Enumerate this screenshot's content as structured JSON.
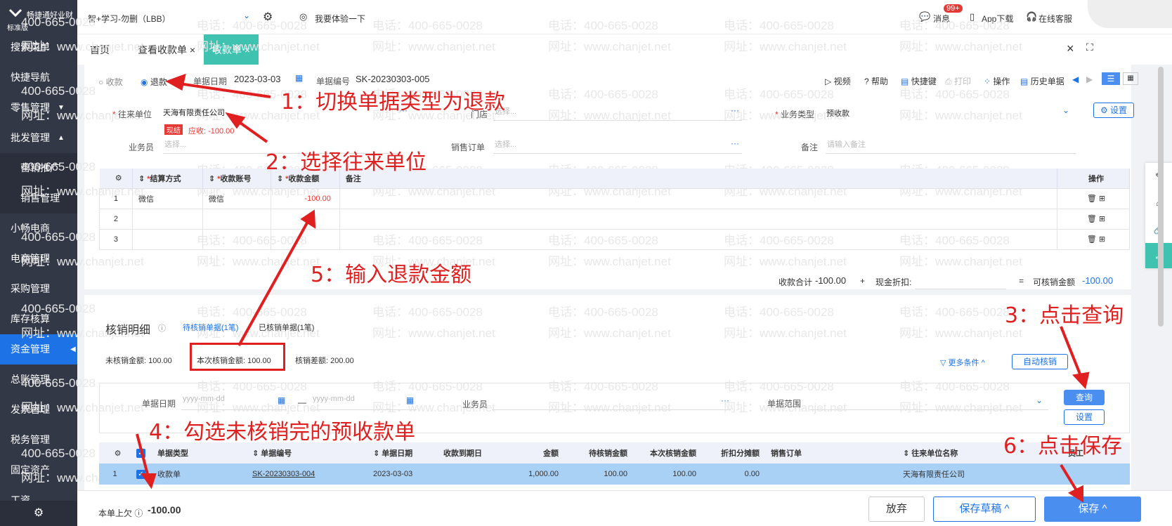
{
  "sidebar": {
    "brand": "畅捷通好业财",
    "edition": "标准版",
    "items": [
      {
        "label": "搜索菜单",
        "type": "top"
      },
      {
        "label": "快捷导航",
        "type": "top"
      },
      {
        "label": "零售管理",
        "type": "top",
        "caret": "▼"
      },
      {
        "label": "批发管理",
        "type": "top",
        "caret": "▲"
      },
      {
        "label": "营销推广",
        "type": "sub"
      },
      {
        "label": "销售管理",
        "type": "sub"
      },
      {
        "label": "小畅电商",
        "type": "top"
      },
      {
        "label": "电商管理",
        "type": "top"
      },
      {
        "label": "采购管理",
        "type": "top"
      },
      {
        "label": "库存核算",
        "type": "top"
      },
      {
        "label": "资金管理",
        "type": "active",
        "caret": "◀"
      },
      {
        "label": "总账管理",
        "type": "top"
      },
      {
        "label": "发票管理",
        "type": "top"
      },
      {
        "label": "税务管理",
        "type": "top"
      },
      {
        "label": "固定资产",
        "type": "top"
      },
      {
        "label": "工资",
        "type": "top"
      }
    ]
  },
  "topbar": {
    "account": "智+学习-勿删（LBB）",
    "try": "我要体验一下",
    "msg": "消息",
    "badge": "99+",
    "app": "App下载",
    "service": "在线客服"
  },
  "tabs": {
    "home": "首页",
    "t1": "查看收款单",
    "t2": "收款单"
  },
  "form": {
    "radio1": "收款",
    "radio2": "退款",
    "date_label": "单据日期",
    "date": "2023-03-03",
    "no_label": "单据编号",
    "no": "SK-20230303-005",
    "video": "视频",
    "help": "帮助",
    "shortcut": "快捷键",
    "print": "打印",
    "op": "操作",
    "history": "历史单据",
    "partner_label": "往来单位",
    "partner": "天海有限责任公司",
    "cash_tag": "现结",
    "receivable": "应收: -100.00",
    "store_label": "门店",
    "store_ph": "选择...",
    "biz_label": "业务类型",
    "biz": "预收款",
    "settings": "设置",
    "sales_label": "业务员",
    "sales_ph": "选择...",
    "order_label": "销售订单",
    "order_ph": "选择...",
    "remark_label": "备注",
    "remark_ph": "请输入备注"
  },
  "grid": {
    "headers": [
      "结算方式",
      "收款账号",
      "收款金额",
      "备注",
      "操作"
    ],
    "rows": [
      {
        "n": "1",
        "m": "微信",
        "a": "微信",
        "v": "-100.00"
      },
      {
        "n": "2"
      },
      {
        "n": "3"
      }
    ]
  },
  "totals": {
    "sum_label": "收款合计",
    "sum": "-100.00",
    "plus": "+",
    "disc_label": "现金折扣:",
    "eq": "=",
    "avail_label": "可核销金额",
    "avail": "-100.00"
  },
  "writeoff": {
    "title": "核销明细",
    "tab1": "待核销单据(1笔)",
    "tab2": "已核销单据(1笔)",
    "unpaid": "未核销金额: 100.00",
    "current": "本次核销金额: 100.00",
    "diff": "核销差额: 200.00",
    "more": "更多条件",
    "auto": "自动核销",
    "date_label": "单据日期",
    "date_ph": "yyyy-mm-dd",
    "dash": "—",
    "sales_label": "业务员",
    "range_label": "单据范围",
    "query": "查询",
    "set": "设置"
  },
  "grid2": {
    "headers": [
      "单据类型",
      "单据编号",
      "单据日期",
      "收款到期日",
      "金额",
      "待核销金额",
      "本次核销金额",
      "折扣分摊额",
      "销售订单",
      "往来单位名称",
      "员工"
    ],
    "row": {
      "n": "1",
      "type": "收款单",
      "no": "SK-20230303-004",
      "date": "2023-03-03",
      "due": "",
      "amt": "1,000.00",
      "pending": "100.00",
      "cur": "100.00",
      "disc": "0.00",
      "order": "",
      "partner": "天海有限责任公司"
    }
  },
  "footer": {
    "last_label": "本单上欠",
    "last": "-100.00",
    "abandon": "放弃",
    "draft": "保存草稿",
    "save": "保存"
  },
  "annotations": {
    "a1": "1：切换单据类型为退款",
    "a2": "2：选择往来单位",
    "a3": "3：点击查询",
    "a4": "4：勾选未核销完的预收款单",
    "a5": "5：输入退款金额",
    "a6": "6：点击保存"
  },
  "watermark": {
    "phone": "电话：400-665-0028",
    "site": "网址：www.chanjet.net",
    "short": "400-665-0028"
  }
}
